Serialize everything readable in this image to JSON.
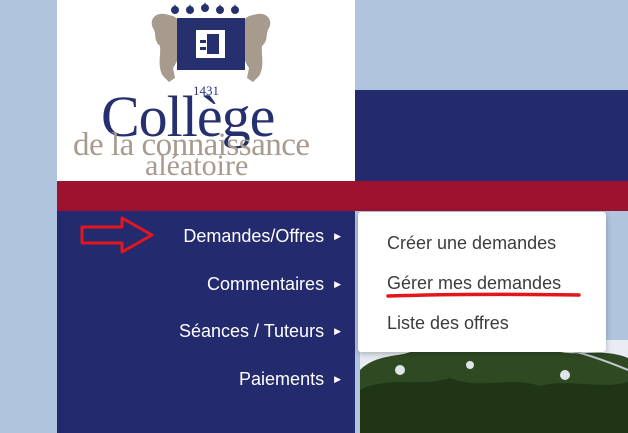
{
  "logo": {
    "year": "1431",
    "title": "Collège",
    "subtitle_line1": "de la connaissance",
    "subtitle_line2": "aléatoire"
  },
  "nav": {
    "items": [
      {
        "label": "Demandes/Offres",
        "icon": "chevron-right-icon"
      },
      {
        "label": "Commentaires",
        "icon": "chevron-right-icon"
      },
      {
        "label": "Séances / Tuteurs",
        "icon": "chevron-right-icon"
      },
      {
        "label": "Paiements",
        "icon": "chevron-right-icon"
      }
    ]
  },
  "dropdown": {
    "items": [
      {
        "label": "Créer une demandes"
      },
      {
        "label": "Gérer mes demandes"
      },
      {
        "label": "Liste des offres"
      }
    ]
  },
  "colors": {
    "navy": "#232a6e",
    "crimson": "#9e1230",
    "sky": "#b0c4de",
    "annotation_red": "#e3161d"
  },
  "annotations": {
    "arrow": "red-outline-arrow-icon",
    "underline": "red-underline"
  }
}
